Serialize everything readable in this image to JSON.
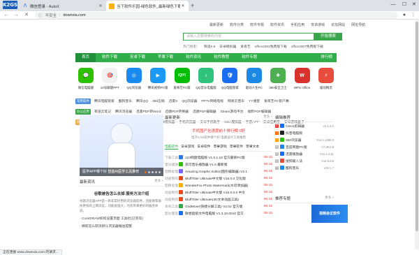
{
  "browser": {
    "logo": "K2GS",
    "tabs": [
      {
        "title": "微信登录 - AutoX",
        "active": false
      },
      {
        "title": "当下软件乐园-绿色软件_最新绿色下载",
        "active": true
      }
    ],
    "insecure_label": "不安全",
    "url": "downxia.com",
    "status": "正在连接 www.downxia.com 的请求..."
  },
  "header": {
    "toplinks": [
      "最新更新",
      "软件分类",
      "软件专题",
      "软件资讯",
      "手机应用",
      "安卓游戏",
      "论坛网站",
      "网址导航"
    ],
    "search_placeholder": "请输入您要搜索的内容",
    "search_button": "开始搜索",
    "hot_label": "热门搜索：",
    "hot_items": [
      "铁道0.8",
      "安卓模拟器",
      "爱奇艺",
      "office2003免费版下载",
      "office2007免费版下载"
    ]
  },
  "nav": {
    "items": [
      "首页",
      "软件下载",
      "安卓下载",
      "苹果下载",
      "软件资讯",
      "软件教程",
      "软件专题"
    ],
    "right": "排行榜"
  },
  "apps": [
    {
      "label": "微信电脑版",
      "icon": "wechat-icon",
      "color": "#2dc100",
      "glyph": "💬"
    },
    {
      "label": "10号解题PPT",
      "icon": "ppt-icon",
      "color": "#f2f2f2",
      "glyph": "🎯"
    },
    {
      "label": "QQ浏览器",
      "icon": "qq-browser-icon",
      "color": "#1a8af0",
      "glyph": "◎"
    },
    {
      "label": "腾讯视频PC版",
      "icon": "tencent-video-icon",
      "color": "#1c99f5",
      "glyph": "▶"
    },
    {
      "label": "爱奇艺PC版",
      "icon": "iqiyi-icon",
      "color": "#00be06",
      "glyph": "iQIYI"
    },
    {
      "label": "QQ音乐电脑版",
      "icon": "qq-music-icon",
      "color": "#31c27c",
      "glyph": "♪"
    },
    {
      "label": "QQ电脑管家",
      "icon": "qq-guard-icon",
      "color": "#1a6cf0",
      "glyph": "🛡"
    },
    {
      "label": "驱动人生PC",
      "icon": "driver-icon",
      "color": "#1e88e5",
      "glyph": "⚙"
    },
    {
      "label": "360安全卫士",
      "icon": "360-security-icon",
      "color": "#4caf50",
      "glyph": "✚"
    },
    {
      "label": "WPS Office",
      "icon": "wps-icon",
      "color": "#d9312b",
      "glyph": "W"
    },
    {
      "label": "驱动精灵",
      "icon": "driver-genius-icon",
      "color": "#e74c3c",
      "glyph": "⚡"
    }
  ],
  "categories": [
    {
      "tag": "常用软件",
      "color": "#4a90e2",
      "items": [
        "腾讯电脑管家",
        "酷狗音乐",
        "腾讯QQ",
        "360压缩",
        "迅雷X",
        "QQ浏览器",
        "PPTV网络电视",
        "网易云音乐",
        "YY语音",
        "爱奇艺PC客户端"
      ]
    },
    {
      "tag": "办公应用",
      "color": "#3aa64c",
      "items": [
        "有道云笔记",
        "腾讯浏览器",
        "迅雷PDF转Word",
        "迅捷PDF转换器",
        "迅捷PDF编辑器",
        "Steam游戏平台",
        "福昕PDF编辑器"
      ]
    },
    {
      "tag": "热门游戏",
      "color": "#f0ad4e",
      "items": [
        "FS模拟器",
        "逍遥模拟器",
        "手机远程控制",
        "安卓模拟器",
        "手机浏览器",
        "安卓手机助手",
        "GBA模拟器",
        "手游APP",
        "安卓应用宝",
        "安卓游戏盒子"
      ]
    }
  ],
  "banner": {
    "caption": "医学APP哪个好 智能AI医学工具推荐"
  },
  "news": {
    "title": "最新资讯",
    "more": "更多 »",
    "headline": "谷歌被告怎么去掉 服务方法介绍",
    "desc": "谷歌浏览器APP是一款非常好用的浏览器软件，还能够帮助你更快的上网浏览，功能很强大，为您带来更好的服务体验。",
    "bullets": [
      "CorelDRAW如何设置页面 工具栏(已完毕)",
      "微软怎么取消默认浏览器推送提醒"
    ]
  },
  "latest": {
    "title": "最新更新",
    "more": "更多 »",
    "ad1": "手机国产化速度前十排行榜 0好",
    "ad2": "电子CAD软件哪个好 电路设计工具推荐",
    "subtabs": [
      "电脑软件",
      "安卓游戏",
      "安卓软件",
      "苹果游戏",
      "苹果软件",
      "苹果文本"
    ],
    "rows": [
      {
        "cat": "下载工具",
        "name": "123网盘电脑版 V1.0.1.10 官方最新PC版",
        "date": "06-15",
        "color": "#2b7de9"
      },
      {
        "cat": "音乐播放",
        "name": "荔可音乐播放器 V1.0 最新版",
        "date": "06-15",
        "color": "#2dc100"
      },
      {
        "cat": "图像处理",
        "name": "Amazing Graphic Editor(图形编辑器) V2.1",
        "date": "06-15",
        "color": "#7b61ff"
      },
      {
        "cat": "动画制作",
        "name": "BluffTitler Ultimate中文版 V16.0.0 汉化版",
        "date": "06-15",
        "color": "#e64a19"
      },
      {
        "cat": "图像处理",
        "name": "WonderFox Photo Watermark(水印添加器)",
        "date": "06-15",
        "color": "#f4b400"
      },
      {
        "cat": "动画制作",
        "name": "BluffTitler Ultimate中文版 V16.0.0.0 中文",
        "date": "06-15",
        "color": "#e64a19"
      },
      {
        "cat": "动画制作",
        "name": "BluffTitler Ultimate(3D文本动画工具)",
        "date": "06-15",
        "color": "#e64a19"
      },
      {
        "cat": "系统工具",
        "name": "GridMove(快捷分屏工具) V2.02 官方版",
        "date": "06-15",
        "color": "#3aa64c"
      },
      {
        "cat": "图文图处",
        "name": "联想超级文件电脑版 V1.3.10.0010 官方",
        "date": "06-15",
        "color": "#1a6cf0"
      }
    ]
  },
  "ranking": {
    "title": "编辑推荐",
    "rows": [
      {
        "num": "1",
        "name": "Cleo1剪辑器",
        "ver": "V1.1.3.1",
        "color": "#1a6cf0",
        "numcolor": "#e33"
      },
      {
        "num": "2",
        "name": "抖音电脑版",
        "ver": "",
        "color": "#222",
        "numcolor": "#f60"
      },
      {
        "num": "3",
        "name": "360浏览器",
        "ver": "V14.1.1006.0",
        "color": "#2dc100",
        "numcolor": "#f90"
      },
      {
        "num": "4",
        "name": "百度网盘PC版",
        "ver": "V7.30.0.8",
        "color": "#1e88e5",
        "numcolor": "#bbb"
      },
      {
        "num": "5",
        "name": "迅雷播放器",
        "ver": "V11.1.4.61",
        "color": "#1a6cf0",
        "numcolor": "#bbb"
      },
      {
        "num": "6",
        "name": "搜狗输入法",
        "ver": "V12.6.0.6",
        "color": "#e74c3c",
        "numcolor": "#bbb"
      },
      {
        "num": "7",
        "name": "酷狗音乐",
        "ver": "V10.1.7",
        "color": "#1a8af0",
        "numcolor": "#bbb"
      }
    ],
    "promo_title": "推荐专题",
    "promo_text": "视频会议软件",
    "more": "更多 »"
  }
}
